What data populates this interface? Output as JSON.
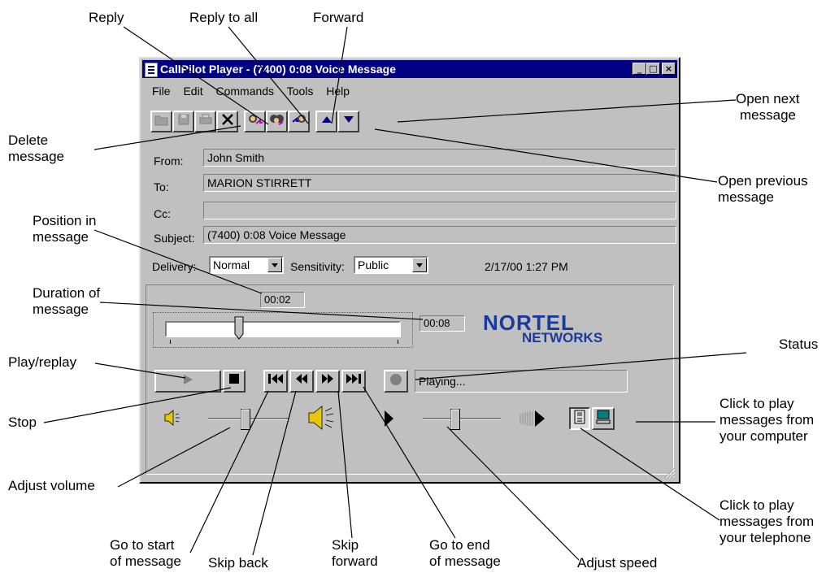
{
  "window": {
    "title": "CallPilot Player - (7400) 0:08 Voice Message",
    "minimize_glyph": "_",
    "maximize_glyph": "□",
    "close_glyph": "×"
  },
  "menu": {
    "file": "File",
    "edit": "Edit",
    "commands": "Commands",
    "tools": "Tools",
    "help": "Help"
  },
  "message": {
    "from_label": "From:",
    "from_value": "John  Smith",
    "to_label": "To:",
    "to_value": "MARION STIRRETT",
    "cc_label": "Cc:",
    "cc_value": "",
    "subject_label": "Subject:",
    "subject_value": "(7400) 0:08 Voice Message",
    "delivery_label": "Delivery:",
    "delivery_value": "Normal",
    "sensitivity_label": "Sensitivity:",
    "sensitivity_value": "Public",
    "date": "2/17/00 1:27 PM"
  },
  "player": {
    "position_time": "00:02",
    "duration_time": "00:08",
    "position_fraction": 0.3,
    "volume_fraction": 0.45,
    "speed_fraction": 0.4,
    "status": "Playing...",
    "logo_line1": "NORTEL",
    "logo_line2": "NETWORKS"
  },
  "callouts": {
    "reply": "Reply",
    "reply_all": "Reply to all",
    "forward": "Forward",
    "open_next_1": "Open next",
    "open_next_2": "message",
    "delete_1": "Delete",
    "delete_2": "message",
    "open_prev_1": "Open previous",
    "open_prev_2": "message",
    "position_1": "Position in",
    "position_2": "message",
    "duration_1": "Duration of",
    "duration_2": "message",
    "status": "Status",
    "play": "Play/replay",
    "stop": "Stop",
    "computer_1": "Click to play",
    "computer_2": "messages from",
    "computer_3": "your computer",
    "volume": "Adjust volume",
    "telephone_1": "Click to play",
    "telephone_2": "messages from",
    "telephone_3": "your telephone",
    "start_1": "Go to start",
    "start_2": "of message",
    "skip_back": "Skip back",
    "skip_fwd_1": "Skip",
    "skip_fwd_2": "forward",
    "end_1": "Go to end",
    "end_2": "of message",
    "speed": "Adjust speed"
  },
  "colors": {
    "titlebar": "#000080",
    "window_face": "#c0c0c0",
    "logo": "#1a3a9a"
  }
}
